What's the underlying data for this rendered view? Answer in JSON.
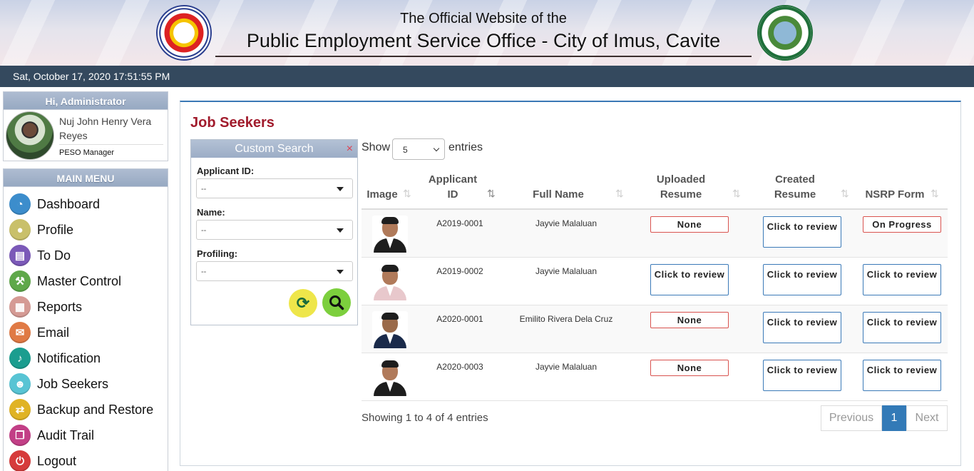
{
  "header": {
    "title_small": "The Official Website of the",
    "title_big": "Public Employment Service Office - City of Imus, Cavite"
  },
  "datetime": "Sat, October 17, 2020 17:51:55 PM",
  "user": {
    "greeting": "Hi, Administrator",
    "name": "Nuj John Henry Vera Reyes",
    "role": "PESO Manager"
  },
  "menu": {
    "title": "MAIN MENU",
    "items": [
      {
        "label": "Dashboard",
        "icon": "dashboard-icon",
        "color": "#3c8dcc"
      },
      {
        "label": "Profile",
        "icon": "user-icon",
        "color": "#c9c06a"
      },
      {
        "label": "To Do",
        "icon": "document-icon",
        "color": "#7b59b8"
      },
      {
        "label": "Master Control",
        "icon": "wrench-icon",
        "color": "#5fa84a"
      },
      {
        "label": "Reports",
        "icon": "table-icon",
        "color": "#d59a94"
      },
      {
        "label": "Email",
        "icon": "envelope-icon",
        "color": "#e07a45"
      },
      {
        "label": "Notification",
        "icon": "bell-icon",
        "color": "#1b9d8f"
      },
      {
        "label": "Job Seekers",
        "icon": "users-icon",
        "color": "#58c4d4"
      },
      {
        "label": "Backup and Restore",
        "icon": "swap-icon",
        "color": "#e0b324"
      },
      {
        "label": "Audit Trail",
        "icon": "copy-icon",
        "color": "#c23f86"
      },
      {
        "label": "Logout",
        "icon": "power-icon",
        "color": "#d63b3b"
      }
    ]
  },
  "page": {
    "title": "Job Seekers"
  },
  "search": {
    "title": "Custom Search",
    "close": "×",
    "applicant_id_label": "Applicant ID:",
    "applicant_id_value": "--",
    "name_label": "Name:",
    "name_value": "--",
    "profiling_label": "Profiling:",
    "profiling_value": "--"
  },
  "table": {
    "show_label": "Show",
    "entries_value": "5",
    "entries_label": "entries",
    "headers": {
      "image": "Image",
      "applicant_id_1": "Applicant",
      "applicant_id_2": "ID",
      "full_name": "Full Name",
      "uploaded_1": "Uploaded",
      "uploaded_2": "Resume",
      "created_1": "Created",
      "created_2": "Resume",
      "nsrp": "NSRP Form"
    },
    "rows": [
      {
        "id": "A2019-0001",
        "name": "Jayvie Malaluan",
        "uploaded": "None",
        "created": "Click to review",
        "nsrp": "On Progress"
      },
      {
        "id": "A2019-0002",
        "name": "Jayvie Malaluan",
        "uploaded": "Click to review",
        "created": "Click to review",
        "nsrp": "Click to review"
      },
      {
        "id": "A2020-0001",
        "name": "Emilito Rivera Dela Cruz",
        "uploaded": "None",
        "created": "Click to review",
        "nsrp": "Click to review"
      },
      {
        "id": "A2020-0003",
        "name": "Jayvie Malaluan",
        "uploaded": "None",
        "created": "Click to review",
        "nsrp": "Click to review"
      }
    ],
    "info": "Showing 1 to 4 of 4 entries",
    "pager": {
      "previous": "Previous",
      "current": "1",
      "next": "Next"
    }
  }
}
